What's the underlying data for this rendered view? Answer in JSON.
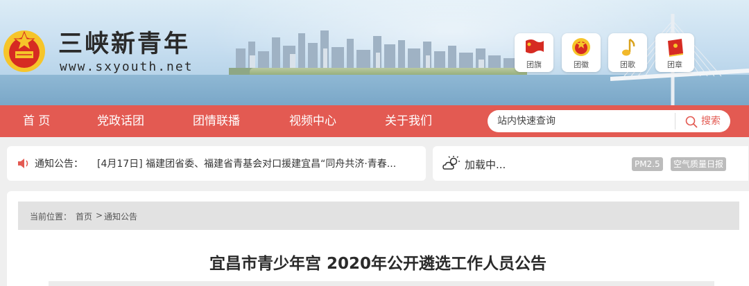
{
  "header": {
    "site_name": "三峡新青年",
    "site_url": "www.sxyouth.net",
    "quick_links": [
      {
        "label": "团旗",
        "icon": "flag-icon"
      },
      {
        "label": "团徽",
        "icon": "emblem-icon"
      },
      {
        "label": "团歌",
        "icon": "music-note-icon"
      },
      {
        "label": "团章",
        "icon": "book-icon"
      }
    ]
  },
  "nav": {
    "items": [
      "首 页",
      "党政话团",
      "团情联播",
      "视频中心",
      "关于我们"
    ],
    "search_placeholder": "站内快速查询",
    "search_button": "搜索"
  },
  "notice": {
    "label": "通知公告：",
    "text": "[4月17日] 福建团省委、福建省青基会对口援建宜昌“同舟共济·青春..."
  },
  "weather": {
    "status": "加载中...",
    "pm25": "PM2.5",
    "air_report": "空气质量日报"
  },
  "breadcrumb": {
    "prefix": "当前位置：",
    "home": "首页",
    "separator": ">",
    "current": "通知公告"
  },
  "article": {
    "title": "宜昌市青少年宫 2020年公开遴选工作人员公告"
  },
  "colors": {
    "nav_red": "#e35a52",
    "accent_red": "#e35a52"
  }
}
